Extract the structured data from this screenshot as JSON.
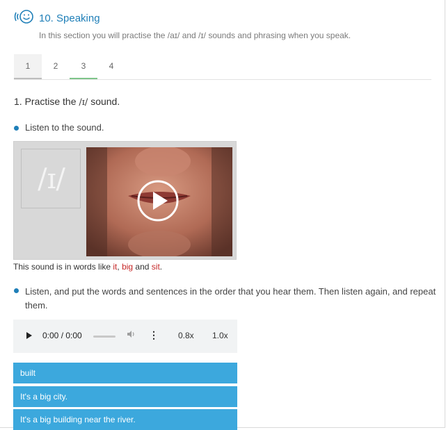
{
  "header": {
    "icon": "speaking-face-icon",
    "title": "10. Speaking",
    "subtitle": "In this section you will practise the /aɪ/ and /ɪ/ sounds and phrasing when you speak."
  },
  "tabs": [
    {
      "label": "1",
      "state": "active"
    },
    {
      "label": "2",
      "state": "normal"
    },
    {
      "label": "3",
      "state": "completed"
    },
    {
      "label": "4",
      "state": "normal"
    }
  ],
  "exercise": {
    "heading_pre": "1. Practise the ",
    "heading_ipa": "/ɪ/",
    "heading_post": " sound.",
    "bullet1": "Listen to the sound.",
    "sound_symbol": "/ɪ/",
    "words_like_pre": "This sound is in words like ",
    "word1": "it",
    "sep1": ", ",
    "word2": "big",
    "sep2": " and ",
    "word3": "sit",
    "end": ".",
    "bullet2": "Listen, and put the words and sentences in the order that you hear them. Then listen again, and repeat them."
  },
  "audio": {
    "time": "0:00 / 0:00",
    "speed_a": "0.8x",
    "speed_b": "1.0x"
  },
  "items": [
    "built",
    "It's a big city.",
    "It's a big building near the river."
  ],
  "colors": {
    "accent": "#1f7fb8",
    "item_bg": "#3ca8dd",
    "highlight_word": "#c62828",
    "tab_complete": "#7ec58a"
  }
}
